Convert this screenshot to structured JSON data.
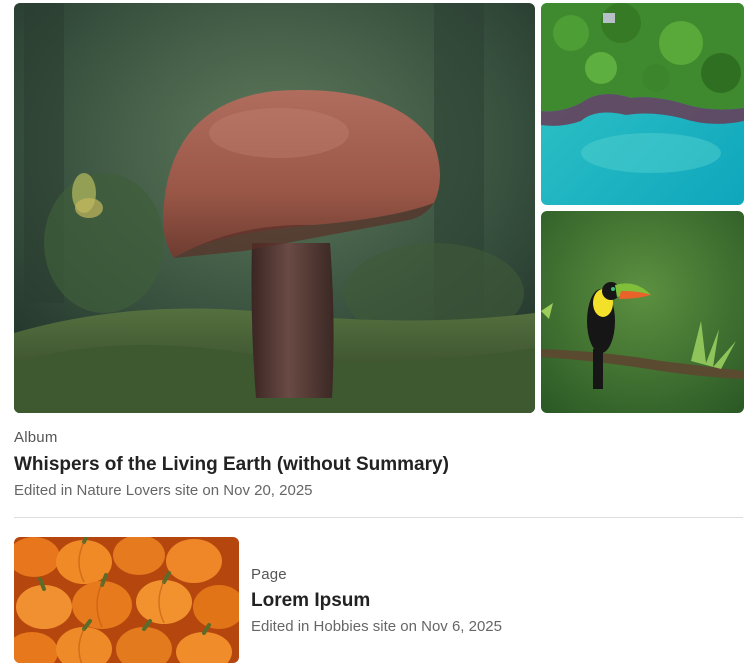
{
  "album": {
    "type_label": "Album",
    "title": "Whispers of the Living Earth (without Summary)",
    "edited_text": "Edited in Nature Lovers site on Nov 20, 2025",
    "images": [
      "mushroom-photo",
      "coastline-aerial-photo",
      "toucan-photo"
    ]
  },
  "page": {
    "type_label": "Page",
    "title": "Lorem Ipsum",
    "edited_text": "Edited in Hobbies site on Nov 6, 2025",
    "image": "pumpkins-photo"
  }
}
